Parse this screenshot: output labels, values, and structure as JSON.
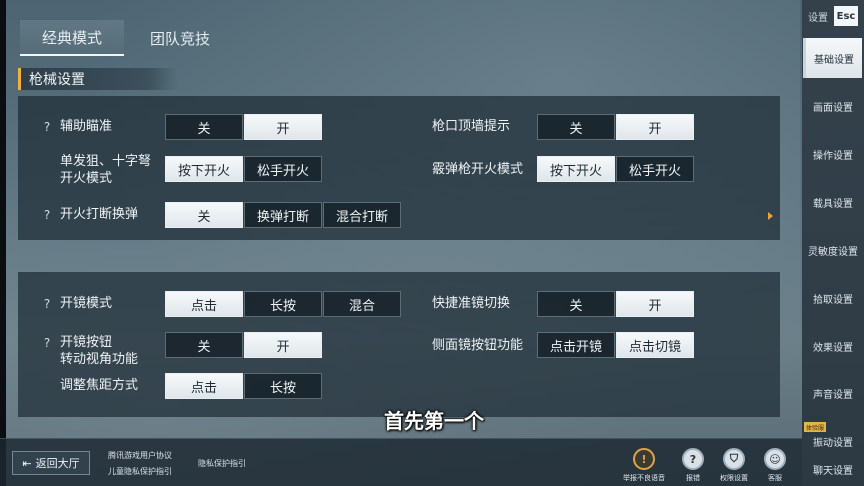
{
  "tabs": [
    {
      "label": "经典模式",
      "active": true
    },
    {
      "label": "团队竞技",
      "active": false
    }
  ],
  "section": {
    "title": "枪械设置"
  },
  "settings": {
    "aim_assist": {
      "help": "?",
      "label": "辅助瞄准",
      "options": [
        "关",
        "开"
      ],
      "selected": 1
    },
    "muzzle_wall": {
      "label": "枪口顶墙提示",
      "options": [
        "关",
        "开"
      ],
      "selected": 1
    },
    "sniper_fire": {
      "label": "单发狙、十字弩\n开火模式",
      "options": [
        "按下开火",
        "松手开火"
      ],
      "selected": 0
    },
    "shotgun_fire": {
      "label": "霰弹枪开火模式",
      "options": [
        "按下开火",
        "松手开火"
      ],
      "selected": 0
    },
    "fire_interrupt": {
      "help": "?",
      "label": "开火打断换弹",
      "options": [
        "关",
        "换弹打断",
        "混合打断"
      ],
      "selected": 0
    },
    "scope_mode": {
      "help": "?",
      "label": "开镜模式",
      "options": [
        "点击",
        "长按",
        "混合"
      ],
      "selected": 0
    },
    "quick_scope": {
      "label": "快捷准镜切换",
      "options": [
        "关",
        "开"
      ],
      "selected": 1
    },
    "scope_btn_view": {
      "help": "?",
      "label": "开镜按钮\n转动视角功能",
      "options": [
        "关",
        "开"
      ],
      "selected": 1
    },
    "side_scope_btn": {
      "label": "侧面镜按钮功能",
      "options": [
        "点击开镜",
        "点击切镜"
      ],
      "selected": 1
    },
    "zoom_mode": {
      "label": "调整焦距方式",
      "options": [
        "点击",
        "长按"
      ],
      "selected": 0
    }
  },
  "sidebar": {
    "top_label": "设置",
    "back_icon_text": "Esc",
    "items": [
      {
        "label": "基础设置",
        "active": true
      },
      {
        "label": "画面设置",
        "active": false
      },
      {
        "label": "操作设置",
        "active": false
      },
      {
        "label": "载具设置",
        "active": false
      },
      {
        "label": "灵敏度设置",
        "active": false
      },
      {
        "label": "拾取设置",
        "active": false
      },
      {
        "label": "效果设置",
        "active": false
      },
      {
        "label": "声音设置",
        "active": false
      },
      {
        "label": "振动设置",
        "active": false
      },
      {
        "label": "聊天设置",
        "active": false
      }
    ],
    "badge": "体验服"
  },
  "bottom": {
    "return_label": "返回大厅",
    "links": [
      "腾讯游戏用户协议",
      "儿童隐私保护指引",
      "隐私保护指引"
    ],
    "icons": [
      {
        "label": "举报不良语音",
        "glyph": "!"
      },
      {
        "label": "报错",
        "glyph": "?"
      },
      {
        "label": "权限设置",
        "glyph": "⛉"
      },
      {
        "label": "客服",
        "glyph": "☺"
      }
    ]
  },
  "subtitle": "首先第一个",
  "colors": {
    "accent": "#f0b238",
    "selected_bg": "#f3f6f8",
    "panel_bg": "#1e2c36"
  }
}
